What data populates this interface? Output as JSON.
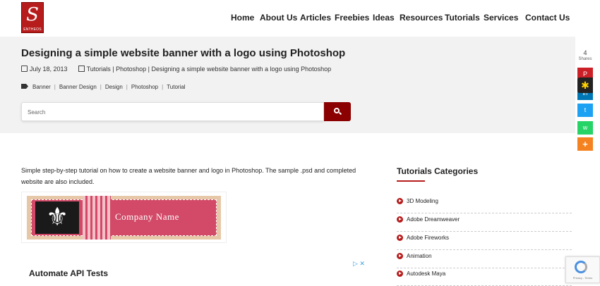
{
  "brand": {
    "logo_text": "ENTHEOS",
    "logo_letter": "S"
  },
  "nav": {
    "items": [
      "Home",
      "About Us",
      "Articles",
      "Freebies",
      "Ideas",
      "Resources",
      "Tutorials",
      "Services",
      "Contact Us"
    ]
  },
  "post": {
    "title": "Designing a simple website banner with a logo using Photoshop",
    "date": "July 18, 2013",
    "breadcrumb": "Tutorials | Photoshop | Designing a simple website banner with a logo using Photoshop",
    "tags": [
      "Banner",
      "Banner Design",
      "Design",
      "Photoshop",
      "Tutorial"
    ],
    "intro": "Simple step-by-step tutorial on how to create a website banner and logo in Photoshop. The sample .psd and completed website are also included.",
    "banner_text": "Company Name"
  },
  "search": {
    "placeholder": "Search"
  },
  "ad": {
    "title": "Automate API Tests",
    "mark": "▷ ✕"
  },
  "sidebar": {
    "title": "Tutorials Categories",
    "categories": [
      "3D Modeling",
      "Adobe Dreamweaver",
      "Adobe Fireworks",
      "Animation",
      "Autodesk Maya"
    ]
  },
  "share": {
    "count": "4",
    "label": "Shares",
    "buttons": [
      {
        "icon": "pinterest-icon",
        "color": "#cb2027",
        "count": "1"
      },
      {
        "icon": "linkedin-icon",
        "color": "#0077b5",
        "count": ""
      },
      {
        "icon": "twitter-icon",
        "color": "#1da1f2",
        "count": "1"
      },
      {
        "icon": "whatsapp-icon",
        "color": "#25d366",
        "count": "2"
      },
      {
        "icon": "more-icon",
        "color": "#f58220",
        "count": ""
      }
    ]
  },
  "recaptcha": {
    "text": "Privacy - Terms"
  }
}
